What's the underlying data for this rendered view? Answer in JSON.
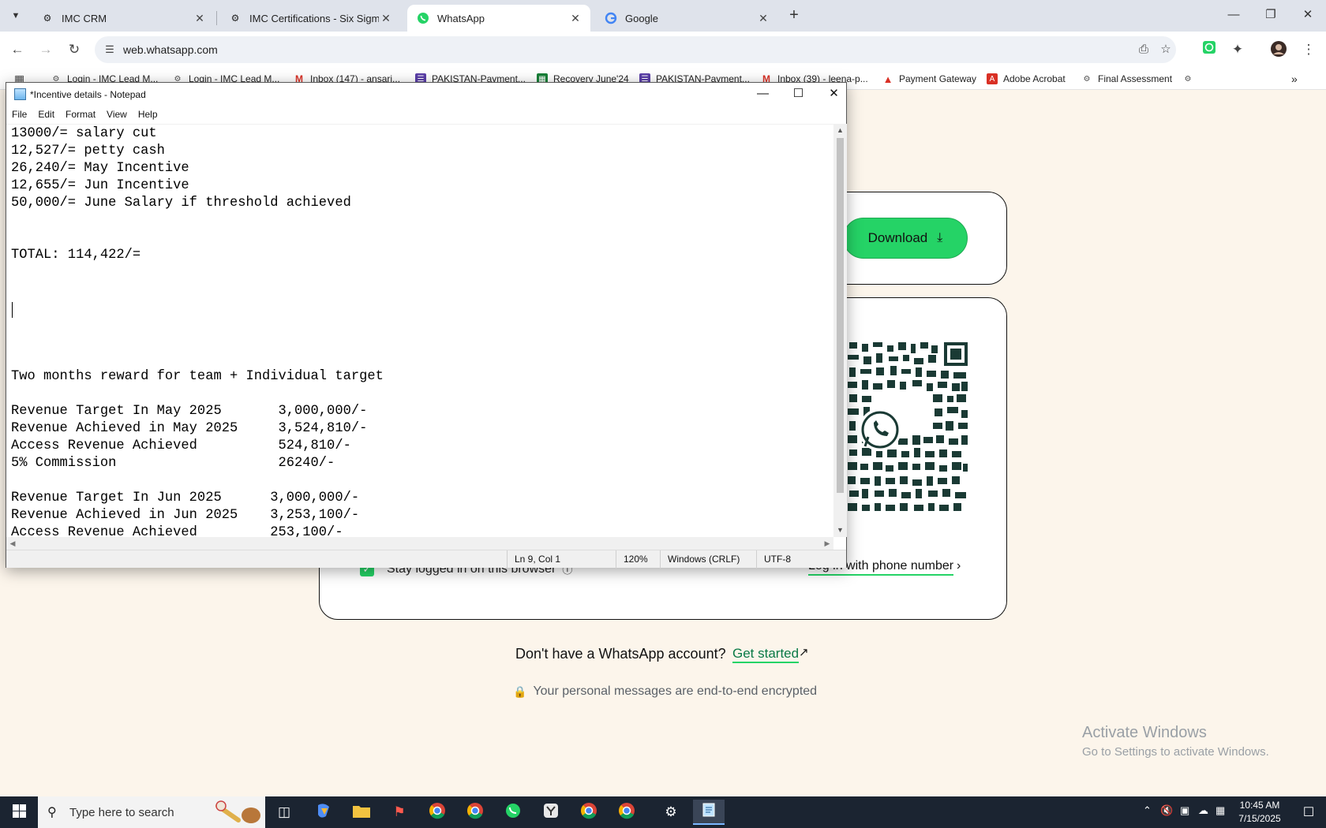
{
  "browser": {
    "tabs": [
      {
        "title": "IMC CRM"
      },
      {
        "title": "IMC Certifications - Six Sigma C"
      },
      {
        "title": "WhatsApp"
      },
      {
        "title": "Google"
      }
    ],
    "url": "web.whatsapp.com",
    "bookmarks": [
      {
        "label": "Login - IMC Lead M..."
      },
      {
        "label": "Login - IMC Lead M..."
      },
      {
        "label": "Inbox (147) - ansari..."
      },
      {
        "label": "PAKISTAN-Payment..."
      },
      {
        "label": "Recovery June'24"
      },
      {
        "label": "PAKISTAN-Payment..."
      },
      {
        "label": "Inbox (39) - leena-p..."
      },
      {
        "label": "Payment Gateway"
      },
      {
        "label": "Adobe Acrobat"
      },
      {
        "label": "Final Assessment"
      }
    ]
  },
  "whatsapp": {
    "download_label": "Download",
    "stay_logged_in": "Stay logged in on this browser",
    "phone_login": "Log in with phone number",
    "no_account": "Don't have a WhatsApp account?",
    "get_started": "Get started",
    "encrypted": "Your personal messages are end-to-end encrypted"
  },
  "notepad": {
    "title": "*Incentive details - Notepad",
    "menu": [
      "File",
      "Edit",
      "Format",
      "View",
      "Help"
    ],
    "content": "13000/= salary cut\n12,527/= petty cash\n26,240/= May Incentive\n12,655/= Jun Incentive\n50,000/= June Salary if threshold achieved\n\n\nTOTAL: 114,422/=\n\n\n\n\n\n\nTwo months reward for team + Individual target\n\nRevenue Target In May 2025       3,000,000/-\nRevenue Achieved in May 2025     3,524,810/-\nAccess Revenue Achieved          524,810/-\n5% Commission                    26240/-\n\nRevenue Target In Jun 2025      3,000,000/-\nRevenue Achieved in Jun 2025    3,253,100/-\nAccess Revenue Achieved         253,100/-",
    "status": {
      "position": "Ln 9, Col 1",
      "zoom": "120%",
      "line_ending": "Windows (CRLF)",
      "encoding": "UTF-8"
    }
  },
  "windows": {
    "activate_title": "Activate Windows",
    "activate_sub": "Go to Settings to activate Windows."
  },
  "taskbar": {
    "search_placeholder": "Type here to search",
    "time": "10:45 AM",
    "date": "7/15/2025"
  },
  "colors": {
    "whatsapp_green": "#25d366",
    "page_bg": "#fcf5eb",
    "taskbar": "#1b2431"
  }
}
